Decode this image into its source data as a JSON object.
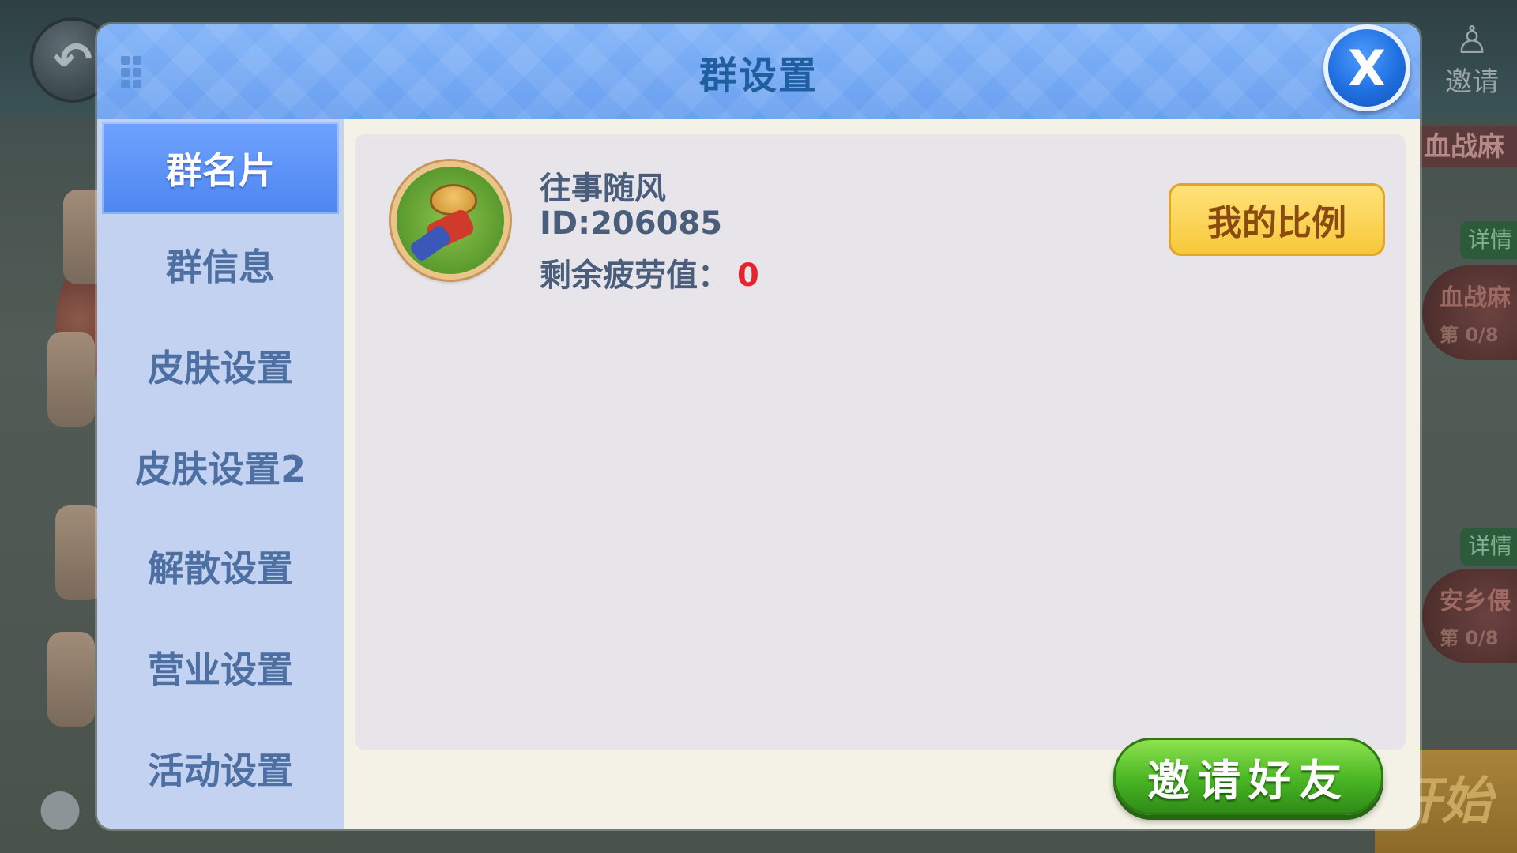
{
  "background": {
    "invite_label": "邀请",
    "right_label_1": "血战麻",
    "detail_label": "详情",
    "room_1_name": "血战麻",
    "room_1_seats": "第 0/8",
    "room_2_name": "安乡偎",
    "room_2_seats": "第 0/8",
    "start_label": "开始"
  },
  "dialog": {
    "title": "群设置",
    "close_label": "X"
  },
  "sidebar": {
    "items": [
      {
        "label": "群名片",
        "active": true
      },
      {
        "label": "群信息",
        "active": false
      },
      {
        "label": "皮肤设置",
        "active": false
      },
      {
        "label": "皮肤设置2",
        "active": false
      },
      {
        "label": "解散设置",
        "active": false
      },
      {
        "label": "营业设置",
        "active": false
      },
      {
        "label": "活动设置",
        "active": false
      }
    ]
  },
  "profile": {
    "name": "往事随风",
    "id_text": "ID:206085",
    "fatigue_label": "剩余疲劳值：",
    "fatigue_value": "0",
    "ratio_button": "我的比例"
  },
  "footer": {
    "invite_button": "邀请好友"
  },
  "colors": {
    "header": "#6aa0f0",
    "title": "#1f5fa0",
    "sidebar": "#c2d2f0",
    "active_tab": "#4d86f0",
    "content_bg": "#e7e5e9",
    "fatigue_value": "#e8232e",
    "ratio_button": "#f7c83a",
    "invite_button": "#49b524"
  }
}
